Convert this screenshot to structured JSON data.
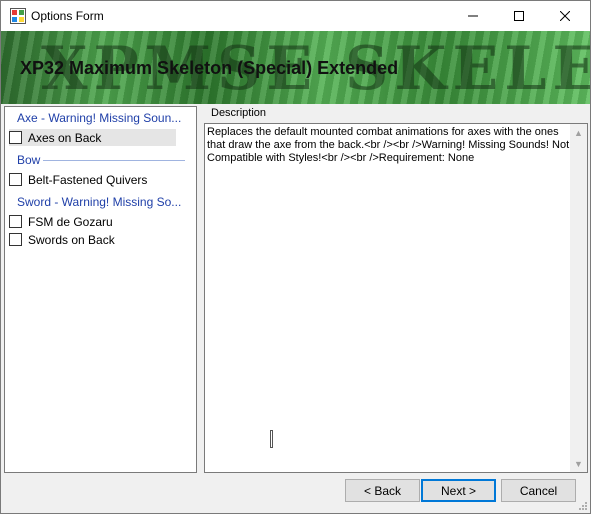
{
  "window": {
    "title": "Options Form",
    "icons": [
      "app-icon",
      "minimize-icon",
      "maximize-icon",
      "close-icon"
    ]
  },
  "banner": {
    "art_text": "XPMSE SKELETON",
    "title": "XP32 Maximum Skeleton (Special) Extended"
  },
  "options": {
    "groups": [
      {
        "header": "Axe - Warning! Missing Soun...",
        "items": [
          {
            "label": "Axes on Back",
            "checked": false,
            "selected": true
          }
        ]
      },
      {
        "header": "Bow",
        "items": [
          {
            "label": "Belt-Fastened Quivers",
            "checked": false,
            "selected": false
          }
        ]
      },
      {
        "header": "Sword - Warning! Missing So...",
        "items": [
          {
            "label": "FSM de Gozaru",
            "checked": false,
            "selected": false
          },
          {
            "label": "Swords on Back",
            "checked": false,
            "selected": false
          }
        ]
      }
    ]
  },
  "description": {
    "legend": "Description",
    "text": "Replaces the default mounted combat animations for axes with the ones that draw the axe from the back.<br /><br />Warning! Missing Sounds! Not Compatible with Styles!<br /><br />Requirement: None"
  },
  "buttons": {
    "back": "< Back",
    "next": "Next >",
    "cancel": "Cancel"
  },
  "colors": {
    "group_header": "#1f3fa8",
    "banner_green": "#4fa84f",
    "default_button_border": "#0078d7"
  }
}
